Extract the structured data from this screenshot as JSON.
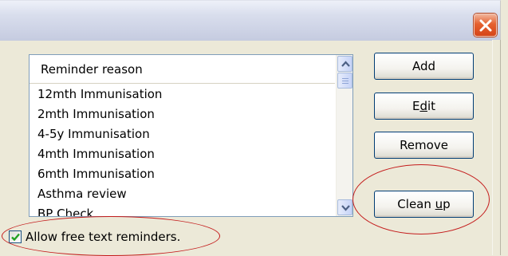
{
  "list": {
    "header": "Reminder reason",
    "items": [
      "12mth Immunisation",
      "2mth Immunisation",
      "4-5y Immunisation",
      "4mth Immunisation",
      "6mth Immunisation",
      "Asthma review",
      "BP Check"
    ]
  },
  "buttons": {
    "add": "Add",
    "edit_pre": "E",
    "edit_key": "d",
    "edit_post": "it",
    "remove": "Remove",
    "cleanup_pre": "Clean ",
    "cleanup_key": "u",
    "cleanup_post": "p"
  },
  "checkbox": {
    "label": "Allow free text reminders.",
    "checked": true
  },
  "colors": {
    "annotation": "#c41c1c",
    "checkmark": "#21a121",
    "close_button": "#e5602f"
  }
}
